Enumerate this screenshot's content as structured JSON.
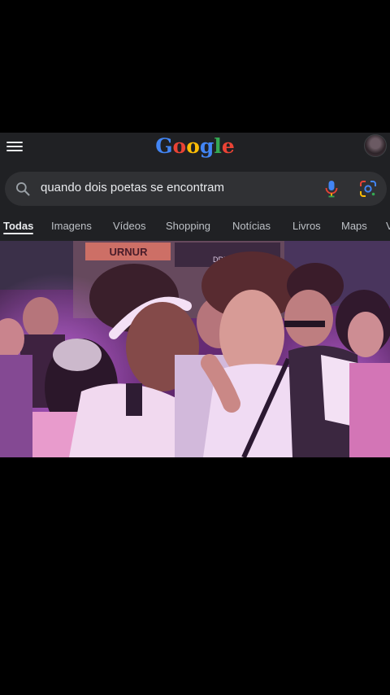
{
  "app": {
    "logo_letters": [
      {
        "char": "G",
        "color": "#4285f4"
      },
      {
        "char": "o",
        "color": "#ea4335"
      },
      {
        "char": "o",
        "color": "#fbbc05"
      },
      {
        "char": "g",
        "color": "#4285f4"
      },
      {
        "char": "l",
        "color": "#34a853"
      },
      {
        "char": "e",
        "color": "#ea4335"
      }
    ]
  },
  "search": {
    "query": "quando dois poetas se encontram"
  },
  "tabs": [
    {
      "label": "Todas",
      "active": true
    },
    {
      "label": "Imagens"
    },
    {
      "label": "Vídeos"
    },
    {
      "label": "Shopping"
    },
    {
      "label": "Notícias"
    },
    {
      "label": "Livros"
    },
    {
      "label": "Maps"
    },
    {
      "label": "V"
    }
  ],
  "video": {
    "sign_left": "URNUR",
    "sign_right": "DREAM"
  },
  "colors": {
    "background": "#202124",
    "search_bg": "#303134",
    "text": "#e8eaed",
    "muted_text": "#bdc1c6"
  }
}
